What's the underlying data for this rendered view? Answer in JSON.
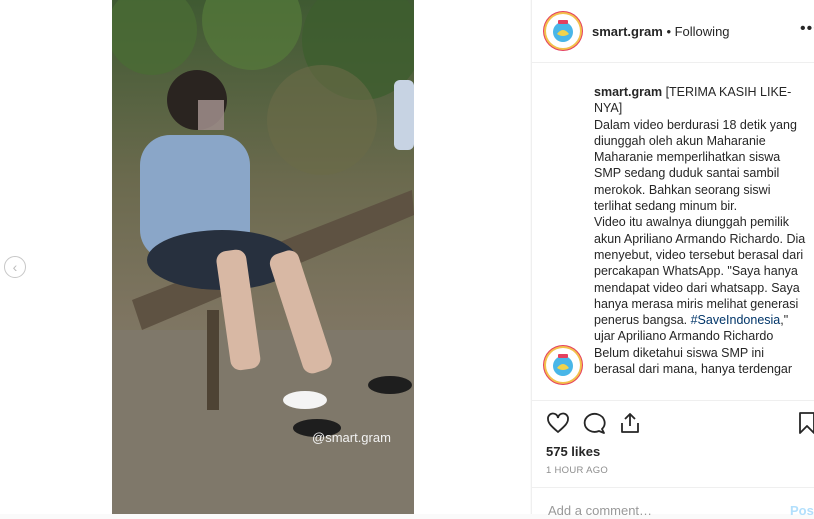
{
  "post": {
    "username": "smart.gram",
    "follow_status": "Following",
    "more_label": "•••",
    "watermark": "@smart.gram",
    "caption": {
      "user": "smart.gram",
      "text_a": "[TERIMA KASIH LIKE-NYA]\nDalam video berdurasi 18 detik yang diunggah oleh akun Maharanie Maharanie memperlihatkan siswa SMP sedang duduk santai sambil merokok. Bahkan seorang siswi terlihat sedang minum bir.\nVideo itu awalnya diunggah pemilik akun Apriliano Armando Richardo. Dia menyebut, video tersebut berasal dari percakapan WhatsApp. \"Saya hanya mendapat video dari whatsapp. Saya hanya merasa miris melihat generasi penerus bangsa. ",
      "hashtag": "#SaveIndonesia",
      "text_b": ",\" ujar Apriliano Armando Richardo\nBelum diketahui siswa SMP ini berasal dari mana, hanya terdengar"
    },
    "likes": "575 likes",
    "time": "1 HOUR AGO",
    "comment_placeholder": "Add a comment…",
    "post_button": "Post"
  },
  "icons": {
    "prev": "chevron-left-icon",
    "like": "heart-icon",
    "comment": "comment-bubble-icon",
    "share": "share-icon",
    "save": "bookmark-icon"
  },
  "colors": {
    "link": "#003569",
    "post_button": "#b2dffc",
    "avatar_ring": "#f3c04b"
  }
}
